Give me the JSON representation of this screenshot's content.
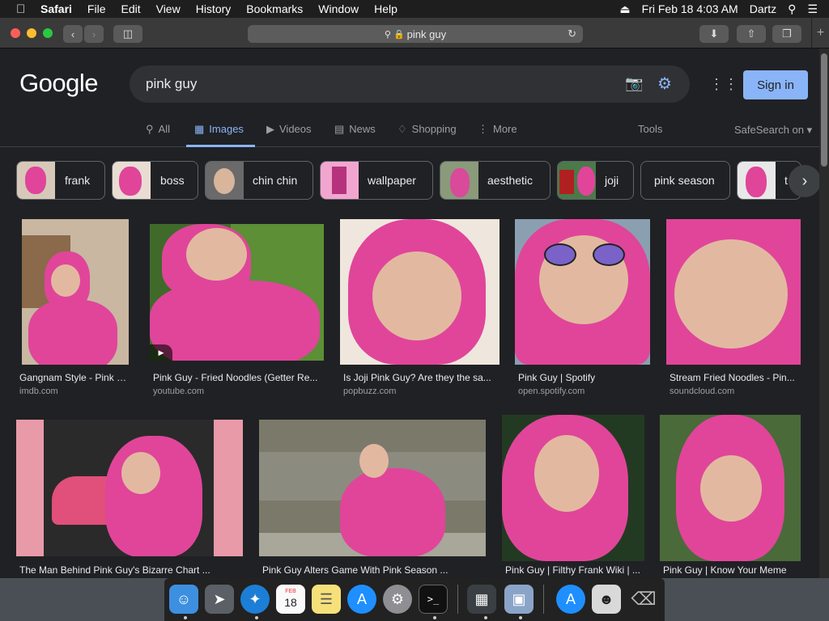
{
  "menubar": {
    "items": [
      "Safari",
      "File",
      "Edit",
      "View",
      "History",
      "Bookmarks",
      "Window",
      "Help"
    ],
    "clock": "Fri Feb 18  4:03 AM",
    "user": "Dartz"
  },
  "browser": {
    "url": "pink guy"
  },
  "google": {
    "logo": "Google",
    "query": "pink guy",
    "sign_in": "Sign in",
    "tabs": [
      "All",
      "Images",
      "Videos",
      "News",
      "Shopping",
      "More"
    ],
    "tools": "Tools",
    "safesearch": "SafeSearch on"
  },
  "chips": [
    "frank",
    "boss",
    "chin chin",
    "wallpaper",
    "aesthetic",
    "joji",
    "pink season",
    "t"
  ],
  "results": [
    {
      "title": "Gangnam Style - Pink G...",
      "source": "imdb.com"
    },
    {
      "title": "Pink Guy - Fried Noodles (Getter Re...",
      "source": "youtube.com"
    },
    {
      "title": "Is Joji Pink Guy? Are they the sa...",
      "source": "popbuzz.com"
    },
    {
      "title": "Pink Guy | Spotify",
      "source": "open.spotify.com"
    },
    {
      "title": "Stream Fried Noodles - Pin...",
      "source": "soundcloud.com"
    },
    {
      "title": "The Man Behind Pink Guy's Bizarre Chart ...",
      "source": ""
    },
    {
      "title": "Pink Guy Alters Game With Pink Season ...",
      "source": ""
    },
    {
      "title": "Pink Guy | Filthy Frank Wiki | ...",
      "source": ""
    },
    {
      "title": "Pink Guy | Know Your Meme",
      "source": ""
    }
  ],
  "dock": {
    "calendar_month": "FEB",
    "calendar_day": "18"
  },
  "colors": {
    "accent": "#8ab4f8",
    "pink": "#e0459a",
    "background": "#202124"
  }
}
